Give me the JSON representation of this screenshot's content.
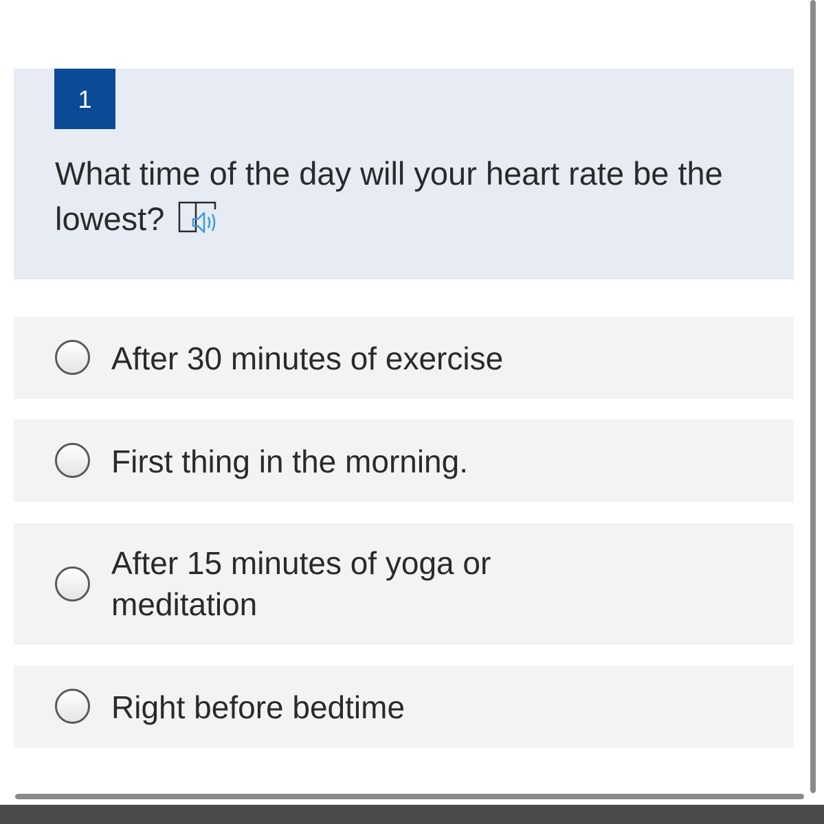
{
  "question": {
    "number": "1",
    "text": "What time of the day will your heart rate be the lowest?",
    "tts_icon": "text-to-speech-icon"
  },
  "options": [
    {
      "label": "After 30 minutes of exercise",
      "selected": false
    },
    {
      "label": "First thing in the morning.",
      "selected": false
    },
    {
      "label": "After 15 minutes of yoga or meditation",
      "selected": false
    },
    {
      "label": "Right before bedtime",
      "selected": false
    }
  ],
  "colors": {
    "number_badge": "#0b4a94",
    "question_bg": "#e7ebf3",
    "option_bg": "#f3f3f3",
    "tts_accent": "#3a9be0"
  }
}
